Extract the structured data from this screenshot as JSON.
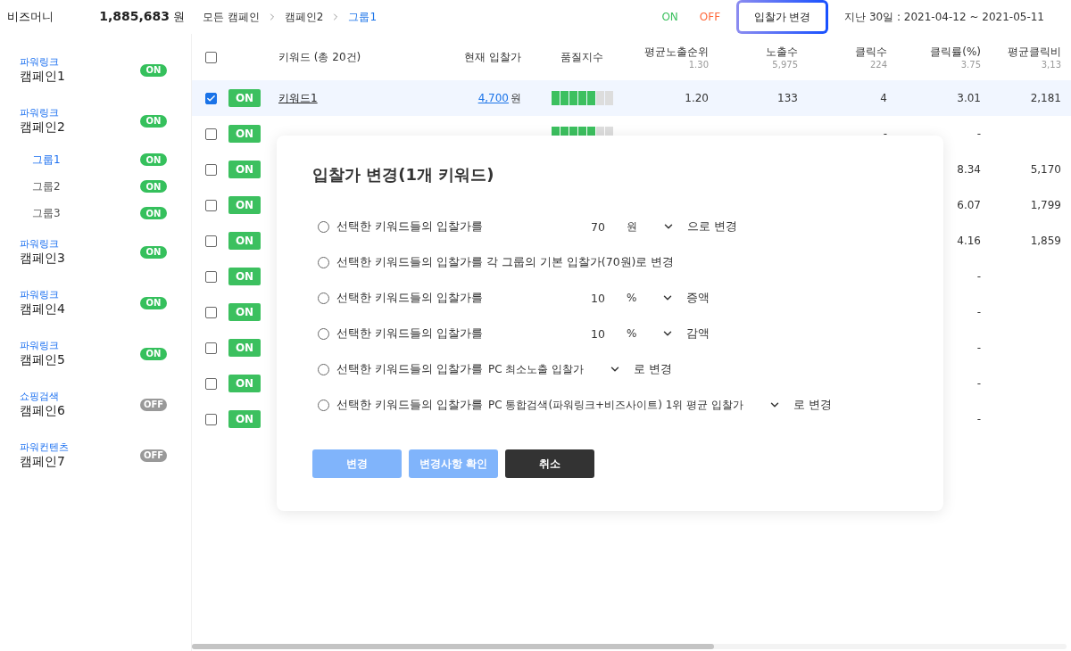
{
  "top_bar": {
    "balance_label": "비즈머니",
    "balance": "1,885,683",
    "balance_unit": "원",
    "breadcrumbs": [
      {
        "label": "모든 캠페인",
        "current": false
      },
      {
        "label": "캠페인2",
        "current": false
      },
      {
        "label": "그룹1",
        "current": true
      }
    ],
    "filters": [
      {
        "label": "ON",
        "kind": "on"
      },
      {
        "label": "OFF",
        "kind": "off"
      }
    ],
    "action_button": "입찰가 변경",
    "period": "지난 30일 : 2021-04-12 ~ 2021-05-11"
  },
  "sidebar": {
    "campaigns": [
      {
        "type": "파워링크",
        "name": "캠페인1",
        "on": true,
        "status": "ON"
      },
      {
        "type": "파워링크",
        "name": "캠페인2",
        "on": true,
        "status": "ON",
        "children": [
          {
            "name": "그룹1",
            "on": true,
            "status": "ON",
            "selected": true
          },
          {
            "name": "그룹2",
            "on": true,
            "status": "ON",
            "selected": false
          },
          {
            "name": "그룹3",
            "on": true,
            "status": "ON",
            "selected": false
          }
        ]
      },
      {
        "type": "파워링크",
        "name": "캠페인3",
        "on": true,
        "status": "ON"
      },
      {
        "type": "파워링크",
        "name": "캠페인4",
        "on": true,
        "status": "ON"
      },
      {
        "type": "파워링크",
        "name": "캠페인5",
        "on": true,
        "status": "ON"
      },
      {
        "type": "쇼핑검색",
        "name": "캠페인6",
        "on": false,
        "status": "OFF"
      },
      {
        "type": "파워컨텐츠",
        "name": "캠페인7",
        "on": false,
        "status": "OFF"
      }
    ]
  },
  "table": {
    "all_checked": false,
    "columns": [
      {
        "label": "키워드 (총 20건)"
      },
      {
        "label": "현재 입찰가"
      },
      {
        "label": "품질지수"
      },
      {
        "label": "평균노출순위",
        "total": "1.30"
      },
      {
        "label": "노출수",
        "total": "5,975"
      },
      {
        "label": "클릭수",
        "total": "224"
      },
      {
        "label": "클릭률(%)",
        "total": "3.75"
      },
      {
        "label": "평균클릭비",
        "total": "3,13"
      }
    ],
    "rows": [
      {
        "checked": true,
        "on": true,
        "status": "ON",
        "keyword": "키워드1",
        "bid": "4,700",
        "bid_unit": "원",
        "level": 0.71,
        "avg_rank": "1.20",
        "impressions": "133",
        "clicks": "4",
        "ctr": "3.01",
        "cpc": "2,181"
      },
      {
        "checked": false,
        "on": true,
        "status": "ON",
        "level": 0.71,
        "clicks": "-",
        "ctr": "-"
      },
      {
        "checked": false,
        "on": true,
        "status": "ON",
        "ctr": "8.34",
        "cpc": "5,170"
      },
      {
        "checked": false,
        "on": true,
        "status": "ON",
        "ctr": "6.07",
        "cpc": "1,799"
      },
      {
        "checked": false,
        "on": true,
        "status": "ON",
        "ctr": "4.16",
        "cpc": "1,859"
      },
      {
        "checked": false,
        "on": true,
        "status": "ON",
        "ctr": "-"
      },
      {
        "checked": false,
        "on": true,
        "status": "ON",
        "ctr": "-"
      },
      {
        "checked": false,
        "on": true,
        "status": "ON",
        "ctr": "-"
      },
      {
        "checked": false,
        "on": true,
        "status": "ON",
        "ctr": "-"
      },
      {
        "checked": false,
        "on": true,
        "status": "ON",
        "ctr": "-"
      }
    ]
  },
  "dialog": {
    "title": "입찰가 변경(1개 키워드)",
    "options": [
      {
        "kind": "amount",
        "selected": false,
        "label": "선택한 키워드들의 입찰가를",
        "value": "70",
        "unit": "원",
        "suffix": "으로 변경"
      },
      {
        "kind": "text",
        "selected": false,
        "label": "선택한 키워드들의 입찰가를 각 그룹의 기본 입찰가(70원)로 변경"
      },
      {
        "kind": "amount",
        "selected": false,
        "label": "선택한 키워드들의 입찰가를",
        "value": "10",
        "unit": "%",
        "suffix": "증액"
      },
      {
        "kind": "amount",
        "selected": false,
        "label": "선택한 키워드들의 입찰가를",
        "value": "10",
        "unit": "%",
        "suffix": "감액"
      },
      {
        "kind": "select",
        "selected": false,
        "label": "선택한 키워드들의 입찰가를",
        "value": "PC 최소노출 입찰가",
        "suffix": "로 변경"
      },
      {
        "kind": "select",
        "selected": false,
        "label": "선택한 키워드들의 입찰가를",
        "value": "PC 통합검색(파워링크+비즈사이트) 1위 평균 입찰가",
        "suffix": "로 변경"
      }
    ],
    "buttons": [
      {
        "label": "변경",
        "kind": "primary",
        "disabled": true
      },
      {
        "label": "변경사항 확인",
        "kind": "primary",
        "disabled": true
      },
      {
        "label": "취소",
        "kind": "dark",
        "disabled": false
      }
    ]
  }
}
